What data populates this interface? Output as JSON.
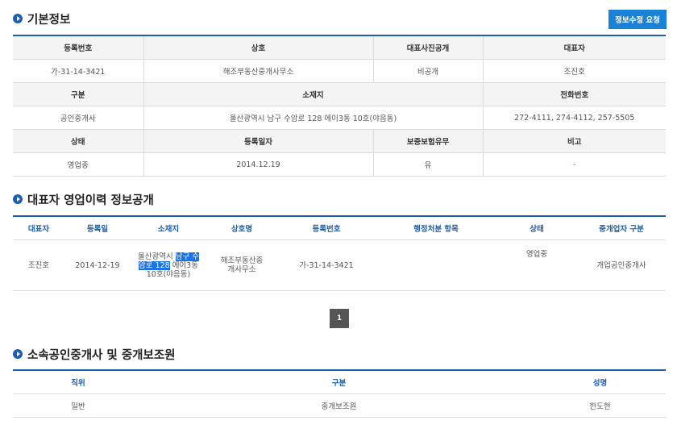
{
  "basic_info": {
    "title": "기본정보",
    "request_button": "정보수정 요청",
    "rows": [
      {
        "type": "header",
        "cells": [
          "등록번호",
          "상호",
          "대표사진공개",
          "대표자"
        ]
      },
      {
        "type": "value",
        "cells": [
          "가-31-14-3421",
          "해조부동산중개사무소",
          "비공개",
          "조진호"
        ]
      },
      {
        "type": "header",
        "cells": [
          "구분",
          "소재지",
          "전화번호"
        ]
      },
      {
        "type": "value",
        "cells": [
          "공인중개사",
          "울산광역시 남구 수암로 128 에이3동 10호(야음동)",
          "272-4111, 274-4112, 257-5505"
        ]
      },
      {
        "type": "header",
        "cells": [
          "상태",
          "등록일자",
          "보증보험유무",
          "비고"
        ]
      },
      {
        "type": "value",
        "cells": [
          "영업중",
          "2014.12.19",
          "유",
          "-"
        ]
      }
    ]
  },
  "history": {
    "title": "대표자 영업이력 정보공개",
    "headers": [
      "대표자",
      "등록일",
      "소재지",
      "상호명",
      "등록번호",
      "행정처분 항목",
      "상태",
      "중개업자 구분"
    ],
    "row": {
      "representative": "조진호",
      "reg_date": "2014-12-19",
      "address_part1": "울산광역시 ",
      "address_highlight1": "남구 수",
      "address_highlight2": "암로 128",
      "address_part2": " 에이3동",
      "address_part3": "10호(야음동)",
      "company_line1": "해조부동산중",
      "company_line2": "개사무소",
      "reg_number": "가-31-14-3421",
      "admin_action": "",
      "status": "영업중",
      "broker_type": "개업공인중개사"
    }
  },
  "pagination": {
    "current": "1"
  },
  "members": {
    "title": "소속공인중개사 및 중개보조원",
    "headers": [
      "직위",
      "구분",
      "성명"
    ],
    "rows": [
      [
        "일반",
        "중개보조원",
        "한도현"
      ]
    ]
  }
}
